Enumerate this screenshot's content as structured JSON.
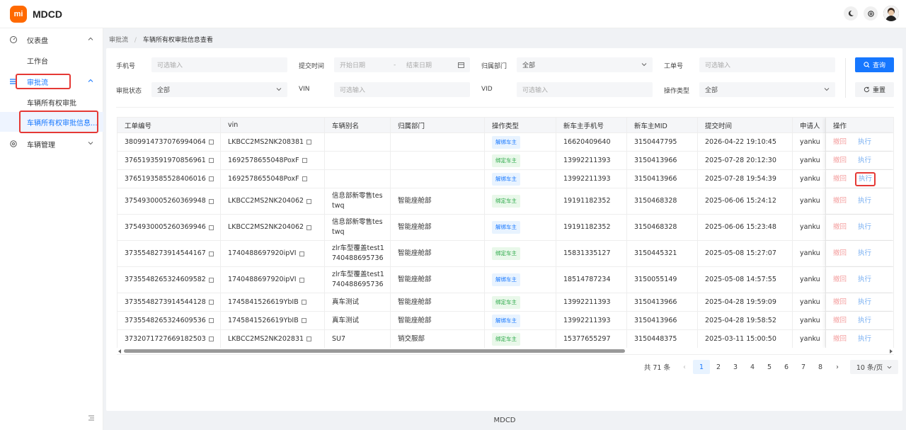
{
  "header": {
    "logo_text": "mi",
    "app_title": "MDCD",
    "icons": [
      "moon-icon",
      "settings-icon",
      "avatar"
    ]
  },
  "sidebar": {
    "items": [
      {
        "label": "仪表盘",
        "icon": "dashboard-icon",
        "expanded": true
      },
      {
        "label": "工作台"
      },
      {
        "label": "审批流",
        "icon": "list-icon",
        "expanded": true
      },
      {
        "label": "车辆所有权审批"
      },
      {
        "label": "车辆所有权审批信息..."
      },
      {
        "label": "车辆管理",
        "icon": "gear-icon",
        "expanded": false
      }
    ],
    "collapse_icon": "menu-fold-icon"
  },
  "breadcrumb": {
    "parent": "审批流",
    "sep": "/",
    "current": "车辆所有权审批信息查看"
  },
  "filters": {
    "phone_label": "手机号",
    "phone_placeholder": "可选输入",
    "submit_time_label": "提交时间",
    "start_placeholder": "开始日期",
    "range_sep": "-",
    "end_placeholder": "结束日期",
    "dept_label": "归属部门",
    "dept_value": "全部",
    "order_label": "工单号",
    "order_placeholder": "可选输入",
    "status_label": "审批状态",
    "status_value": "全部",
    "vin_label": "VIN",
    "vin_placeholder": "可选输入",
    "vid_label": "VID",
    "vid_placeholder": "可选输入",
    "optype_label": "操作类型",
    "optype_value": "全部",
    "query_button": "查询",
    "reset_button": "重置"
  },
  "table": {
    "columns": [
      "工单编号",
      "vin",
      "车辆别名",
      "归属部门",
      "操作类型",
      "新车主手机号",
      "新车主MID",
      "提交时间",
      "申请人",
      "操作"
    ],
    "rows": [
      {
        "id": "3809914737076994064",
        "vin": "LKBCC2MS2NK208381",
        "alias": "",
        "dept": "",
        "op": "解绑车主",
        "phone": "16620409640",
        "mid": "3150447795",
        "time": "2026-04-22 19:10:45",
        "applicant": "yanku"
      },
      {
        "id": "3765193591970856961",
        "vin": "1692578655048PoxF",
        "alias": "",
        "dept": "",
        "op": "绑定车主",
        "phone": "13992211393",
        "mid": "3150413966",
        "time": "2025-07-28 20:12:30",
        "applicant": "yanku"
      },
      {
        "id": "3765193585528406016",
        "vin": "1692578655048PoxF",
        "alias": "",
        "dept": "",
        "op": "解绑车主",
        "phone": "13992211393",
        "mid": "3150413966",
        "time": "2025-07-28 19:54:39",
        "applicant": "yanku"
      },
      {
        "id": "3754930005260369948",
        "vin": "LKBCC2MS2NK204062",
        "alias": "信息部新零售tes twq",
        "dept": "智能座舱部",
        "op": "绑定车主",
        "phone": "19191182352",
        "mid": "3150468328",
        "time": "2025-06-06 15:24:12",
        "applicant": "yanku"
      },
      {
        "id": "3754930005260369946",
        "vin": "LKBCC2MS2NK204062",
        "alias": "信息部新零售tes twq",
        "dept": "智能座舱部",
        "op": "解绑车主",
        "phone": "19191182352",
        "mid": "3150468328",
        "time": "2025-06-06 15:23:48",
        "applicant": "yanku"
      },
      {
        "id": "3735548273914544167",
        "vin": "1740488697920ipVI",
        "alias": "zlr车型覆盖test1 740488695736",
        "dept": "智能座舱部",
        "op": "绑定车主",
        "phone": "15831335127",
        "mid": "3150445321",
        "time": "2025-05-08 15:27:07",
        "applicant": "yanku"
      },
      {
        "id": "3735548265324609582",
        "vin": "1740488697920ipVI",
        "alias": "zlr车型覆盖test1 740488695736",
        "dept": "智能座舱部",
        "op": "解绑车主",
        "phone": "18514787234",
        "mid": "3150055149",
        "time": "2025-05-08 14:57:55",
        "applicant": "yanku"
      },
      {
        "id": "3735548273914544128",
        "vin": "1745841526619YbIB",
        "alias": "真车测试",
        "dept": "智能座舱部",
        "op": "绑定车主",
        "phone": "13992211393",
        "mid": "3150413966",
        "time": "2025-04-28 19:59:09",
        "applicant": "yanku"
      },
      {
        "id": "3735548265324609536",
        "vin": "1745841526619YbIB",
        "alias": "真车测试",
        "dept": "智能座舱部",
        "op": "解绑车主",
        "phone": "13992211393",
        "mid": "3150413966",
        "time": "2025-04-28 19:58:52",
        "applicant": "yanku"
      },
      {
        "id": "3732071727669182503",
        "vin": "LKBCC2MS2NK202831",
        "alias": "SU7",
        "dept": "销交服部",
        "op": "绑定车主",
        "phone": "15377655297",
        "mid": "3150448375",
        "time": "2025-03-11 15:00:50",
        "applicant": "yanku"
      }
    ],
    "action_revoke": "撤回",
    "action_exec": "执行"
  },
  "pagination": {
    "total": "共 71 条",
    "prev": "‹",
    "next": "›",
    "pages": [
      "1",
      "2",
      "3",
      "4",
      "5",
      "6",
      "7",
      "8"
    ],
    "active": "1",
    "page_size": "10 条/页"
  },
  "footer": {
    "text": "MDCD"
  },
  "colors": {
    "primary": "#1677ff",
    "logo": "#ff6900",
    "highlight": "#e53935"
  }
}
